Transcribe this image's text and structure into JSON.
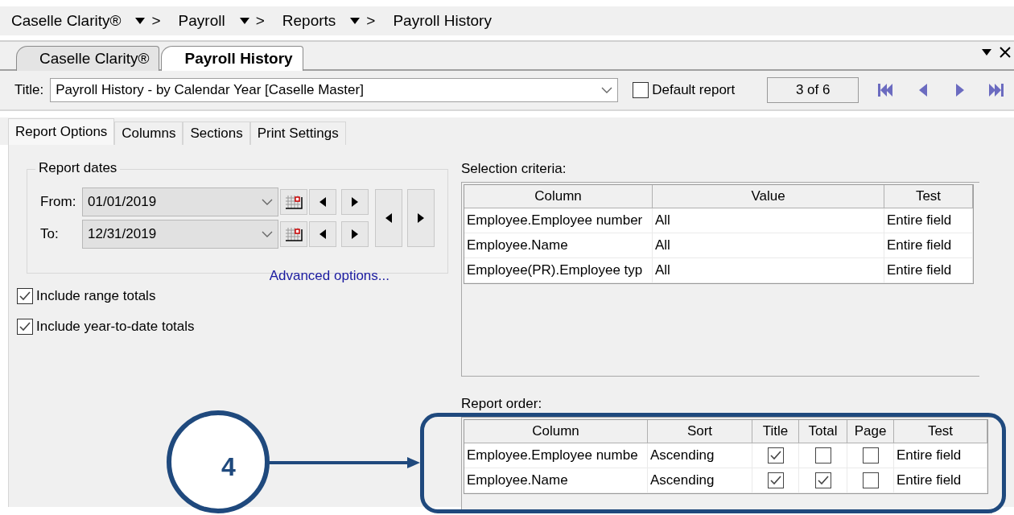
{
  "breadcrumb": [
    {
      "label": "Caselle Clarity®",
      "separator": ">",
      "dropdown": true
    },
    {
      "label": "Payroll",
      "separator": ">",
      "dropdown": true
    },
    {
      "label": "Reports",
      "separator": ">",
      "dropdown": true
    },
    {
      "label": "Payroll History",
      "dropdown": false
    }
  ],
  "document_tabs": [
    {
      "label": "Caselle Clarity®",
      "selected": false
    },
    {
      "label": "Payroll History",
      "selected": true
    }
  ],
  "title_row": {
    "label": "Title:",
    "value": "Payroll History - by Calendar Year [Caselle Master]",
    "default_report": {
      "label": "Default report",
      "checked": false
    },
    "record": "3 of 6"
  },
  "option_tabs": [
    {
      "label": "Report Options",
      "selected": true
    },
    {
      "label": "Columns",
      "selected": false
    },
    {
      "label": "Sections",
      "selected": false
    },
    {
      "label": "Print Settings",
      "selected": false
    }
  ],
  "report_dates": {
    "title": "Report dates",
    "rows": [
      {
        "label": "From:",
        "value": "01/01/2019"
      },
      {
        "label": "To:",
        "value": "12/31/2019"
      }
    ],
    "link": "Advanced options..."
  },
  "options": [
    {
      "label": "Include range totals",
      "checked": true
    },
    {
      "label": "Include year-to-date totals",
      "checked": true
    }
  ],
  "selection_criteria": {
    "title": "Selection criteria:",
    "columns": [
      "Column",
      "Value",
      "Test"
    ],
    "rows": [
      [
        "Employee.Employee number",
        "All",
        "Entire field"
      ],
      [
        "Employee.Name",
        "All",
        "Entire field"
      ],
      [
        "Employee(PR).Employee typ",
        "All",
        "Entire field"
      ]
    ]
  },
  "report_order": {
    "title": "Report order:",
    "columns": [
      "Column",
      "Sort",
      "Title",
      "Total",
      "Page",
      "Test"
    ],
    "rows": [
      {
        "column": "Employee.Employee numbe",
        "sort": "Ascending",
        "title": true,
        "total": false,
        "page": false,
        "test": "Entire field"
      },
      {
        "column": "Employee.Name",
        "sort": "Ascending",
        "title": true,
        "total": true,
        "page": false,
        "test": "Entire field"
      }
    ]
  },
  "callout": {
    "number": "4"
  }
}
